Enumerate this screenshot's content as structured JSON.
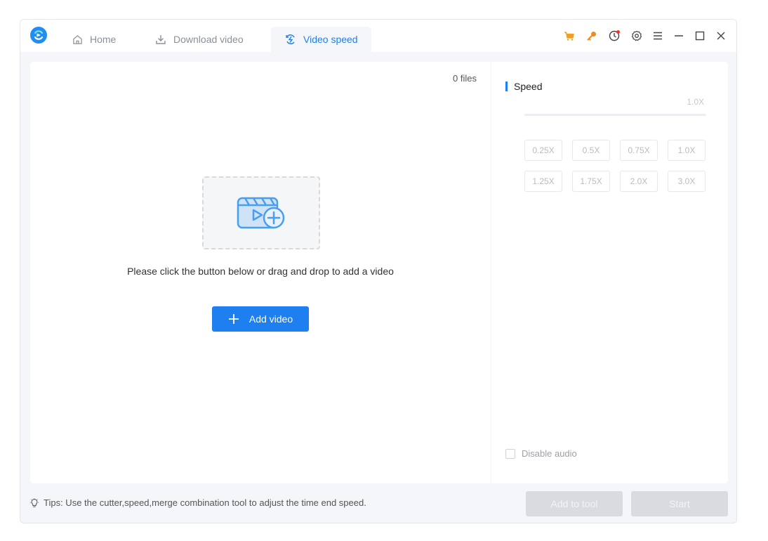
{
  "tabs": {
    "home": "Home",
    "download": "Download video",
    "speed": "Video speed"
  },
  "main": {
    "file_count": "0 files",
    "drop_hint": "Please click the button below or drag and drop to add a video",
    "add_video_label": "Add video"
  },
  "speed_panel": {
    "title": "Speed",
    "current_value": "1.0X",
    "options": [
      "0.25X",
      "0.5X",
      "0.75X",
      "1.0X",
      "1.25X",
      "1.75X",
      "2.0X",
      "3.0X"
    ],
    "disable_audio_label": "Disable audio"
  },
  "footer": {
    "tips": "Tips: Use the cutter,speed,merge combination tool to adjust the time end speed.",
    "add_to_tool_label": "Add to tool",
    "start_label": "Start"
  },
  "colors": {
    "accent": "#1e7ff0",
    "cart_icon": "#f0a020",
    "key_icon": "#f08a20",
    "disabled_button": "#d9dbdf"
  }
}
